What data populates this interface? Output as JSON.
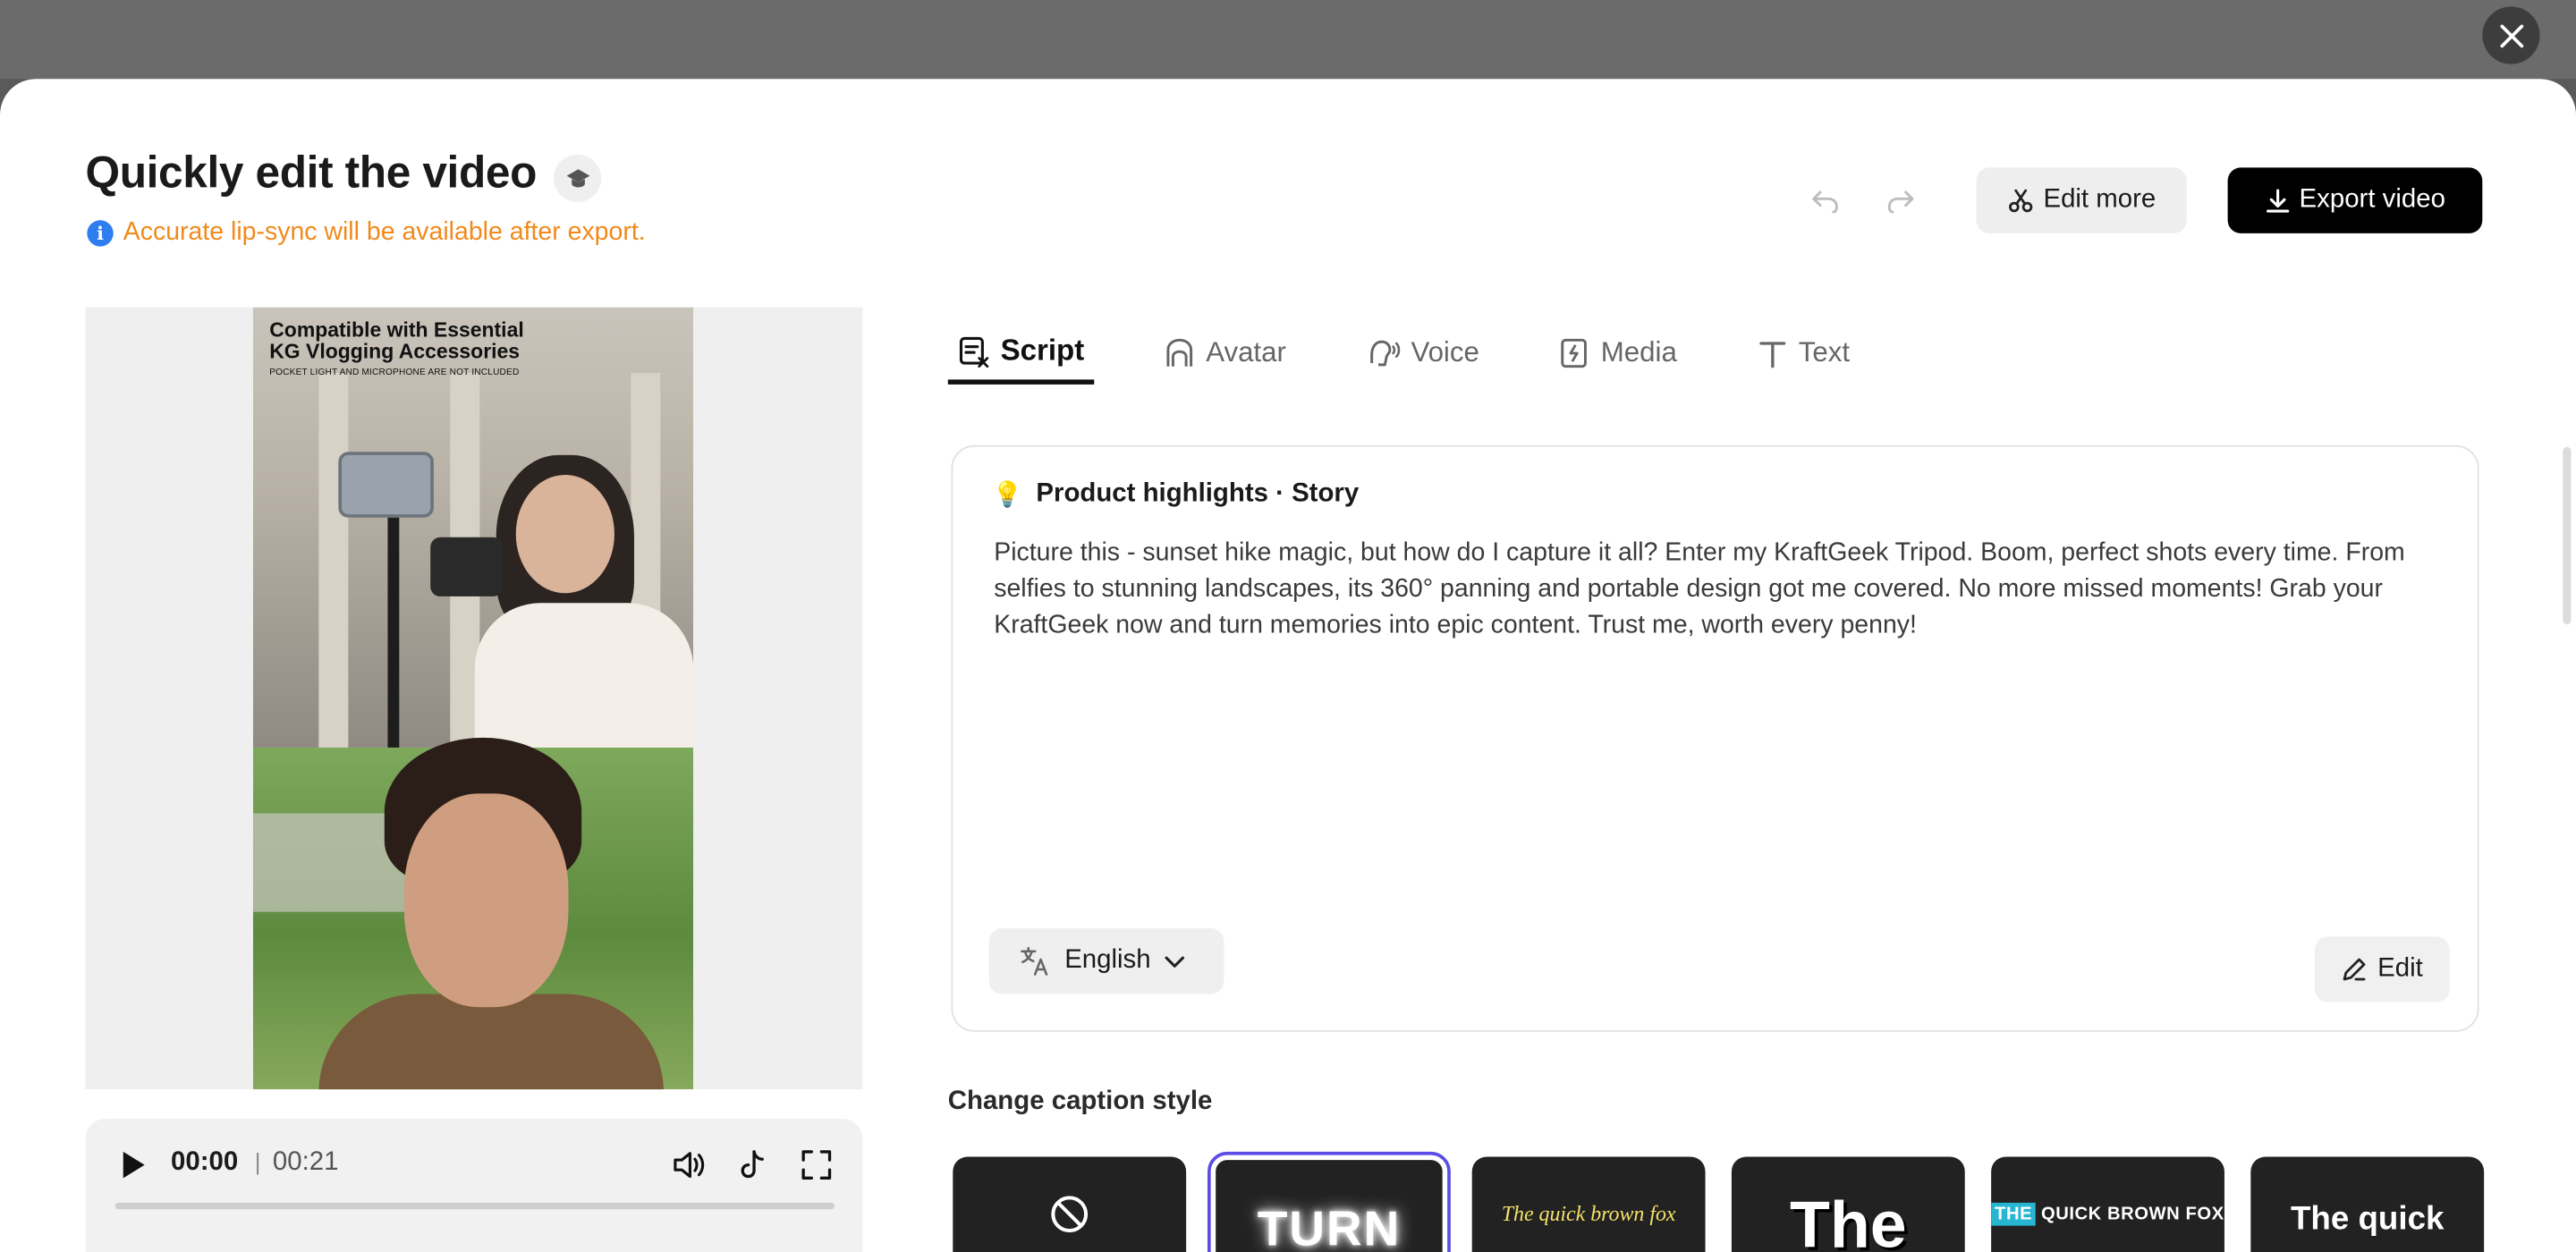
{
  "header": {
    "title": "Quickly edit the video",
    "notice": "Accurate lip-sync will be available after export.",
    "edit_more_label": "Edit more",
    "export_label": "Export video"
  },
  "preview": {
    "overlay_line1": "Compatible with Essential",
    "overlay_line2": "KG Vlogging Accessories",
    "overlay_small": "POCKET LIGHT AND MICROPHONE ARE NOT INCLUDED"
  },
  "player": {
    "current_time": "00:00",
    "separator": "|",
    "total_time": "00:21",
    "progress": 0
  },
  "tabs": [
    {
      "label": "Script",
      "icon": "script-icon",
      "active": true
    },
    {
      "label": "Avatar",
      "icon": "avatar-icon",
      "active": false
    },
    {
      "label": "Voice",
      "icon": "voice-icon",
      "active": false
    },
    {
      "label": "Media",
      "icon": "media-icon",
      "active": false
    },
    {
      "label": "Text",
      "icon": "text-icon",
      "active": false
    }
  ],
  "script": {
    "heading": "Product highlights · Story",
    "body": "Picture this - sunset hike magic, but how do I capture it all? Enter my KraftGeek Tripod. Boom, perfect shots every time. From selfies to stunning landscapes, its 360° panning and portable design got me covered. No more missed moments! Grab your KraftGeek now and turn memories into epic content. Trust me, worth every penny!",
    "language": "English",
    "edit_label": "Edit"
  },
  "captions": {
    "title": "Change caption style",
    "styles": [
      {
        "name": "none",
        "text": ""
      },
      {
        "name": "turn",
        "text": "TURN",
        "selected": true
      },
      {
        "name": "fox-italic",
        "text": "The quick brown fox"
      },
      {
        "name": "the-bold",
        "text": "The"
      },
      {
        "name": "quick-brown-fox-caps",
        "text_highlight": "THE",
        "text": " QUICK BROWN FOX"
      },
      {
        "name": "the-quick",
        "text": "The quick"
      }
    ]
  },
  "colors": {
    "accent": "#5b4de6",
    "notice": "#f08a1c",
    "info": "#2f7ef0",
    "primary_button": "#000000"
  }
}
